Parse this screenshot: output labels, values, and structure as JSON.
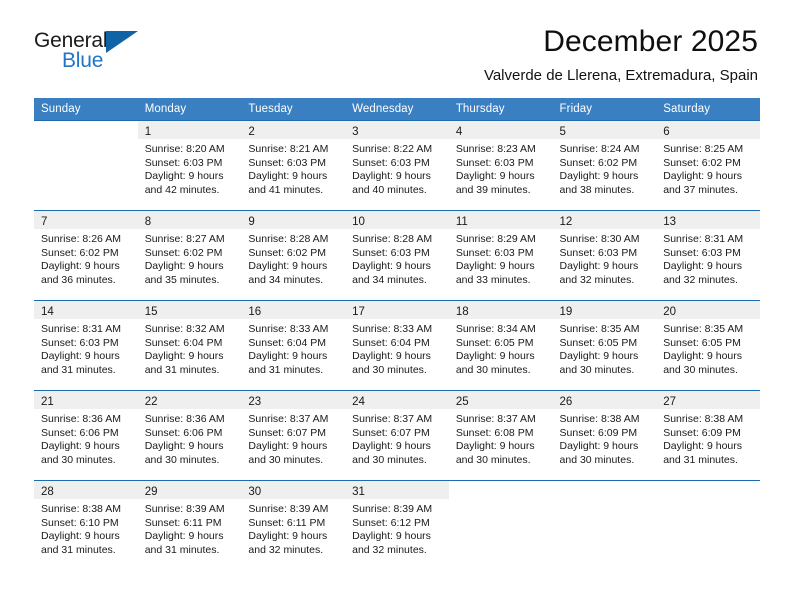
{
  "brand": {
    "word_one": "General",
    "word_two": "Blue",
    "triangle_icon": "triangle-logo-icon",
    "accent_color": "#1163a8",
    "blue_text_color": "#2176c7"
  },
  "header": {
    "title": "December 2025",
    "subtitle": "Valverde de Llerena, Extremadura, Spain"
  },
  "calendar": {
    "header_bg": "#3a7fc1",
    "row_divider_color": "#1e6cb0",
    "daynum_band_color": "#efefef",
    "weekdays": [
      "Sunday",
      "Monday",
      "Tuesday",
      "Wednesday",
      "Thursday",
      "Friday",
      "Saturday"
    ],
    "weeks": [
      [
        {
          "day": "",
          "sunrise": "",
          "sunset": "",
          "daylight_a": "",
          "daylight_b": ""
        },
        {
          "day": "1",
          "sunrise": "Sunrise: 8:20 AM",
          "sunset": "Sunset: 6:03 PM",
          "daylight_a": "Daylight: 9 hours",
          "daylight_b": "and 42 minutes."
        },
        {
          "day": "2",
          "sunrise": "Sunrise: 8:21 AM",
          "sunset": "Sunset: 6:03 PM",
          "daylight_a": "Daylight: 9 hours",
          "daylight_b": "and 41 minutes."
        },
        {
          "day": "3",
          "sunrise": "Sunrise: 8:22 AM",
          "sunset": "Sunset: 6:03 PM",
          "daylight_a": "Daylight: 9 hours",
          "daylight_b": "and 40 minutes."
        },
        {
          "day": "4",
          "sunrise": "Sunrise: 8:23 AM",
          "sunset": "Sunset: 6:03 PM",
          "daylight_a": "Daylight: 9 hours",
          "daylight_b": "and 39 minutes."
        },
        {
          "day": "5",
          "sunrise": "Sunrise: 8:24 AM",
          "sunset": "Sunset: 6:02 PM",
          "daylight_a": "Daylight: 9 hours",
          "daylight_b": "and 38 minutes."
        },
        {
          "day": "6",
          "sunrise": "Sunrise: 8:25 AM",
          "sunset": "Sunset: 6:02 PM",
          "daylight_a": "Daylight: 9 hours",
          "daylight_b": "and 37 minutes."
        }
      ],
      [
        {
          "day": "7",
          "sunrise": "Sunrise: 8:26 AM",
          "sunset": "Sunset: 6:02 PM",
          "daylight_a": "Daylight: 9 hours",
          "daylight_b": "and 36 minutes."
        },
        {
          "day": "8",
          "sunrise": "Sunrise: 8:27 AM",
          "sunset": "Sunset: 6:02 PM",
          "daylight_a": "Daylight: 9 hours",
          "daylight_b": "and 35 minutes."
        },
        {
          "day": "9",
          "sunrise": "Sunrise: 8:28 AM",
          "sunset": "Sunset: 6:02 PM",
          "daylight_a": "Daylight: 9 hours",
          "daylight_b": "and 34 minutes."
        },
        {
          "day": "10",
          "sunrise": "Sunrise: 8:28 AM",
          "sunset": "Sunset: 6:03 PM",
          "daylight_a": "Daylight: 9 hours",
          "daylight_b": "and 34 minutes."
        },
        {
          "day": "11",
          "sunrise": "Sunrise: 8:29 AM",
          "sunset": "Sunset: 6:03 PM",
          "daylight_a": "Daylight: 9 hours",
          "daylight_b": "and 33 minutes."
        },
        {
          "day": "12",
          "sunrise": "Sunrise: 8:30 AM",
          "sunset": "Sunset: 6:03 PM",
          "daylight_a": "Daylight: 9 hours",
          "daylight_b": "and 32 minutes."
        },
        {
          "day": "13",
          "sunrise": "Sunrise: 8:31 AM",
          "sunset": "Sunset: 6:03 PM",
          "daylight_a": "Daylight: 9 hours",
          "daylight_b": "and 32 minutes."
        }
      ],
      [
        {
          "day": "14",
          "sunrise": "Sunrise: 8:31 AM",
          "sunset": "Sunset: 6:03 PM",
          "daylight_a": "Daylight: 9 hours",
          "daylight_b": "and 31 minutes."
        },
        {
          "day": "15",
          "sunrise": "Sunrise: 8:32 AM",
          "sunset": "Sunset: 6:04 PM",
          "daylight_a": "Daylight: 9 hours",
          "daylight_b": "and 31 minutes."
        },
        {
          "day": "16",
          "sunrise": "Sunrise: 8:33 AM",
          "sunset": "Sunset: 6:04 PM",
          "daylight_a": "Daylight: 9 hours",
          "daylight_b": "and 31 minutes."
        },
        {
          "day": "17",
          "sunrise": "Sunrise: 8:33 AM",
          "sunset": "Sunset: 6:04 PM",
          "daylight_a": "Daylight: 9 hours",
          "daylight_b": "and 30 minutes."
        },
        {
          "day": "18",
          "sunrise": "Sunrise: 8:34 AM",
          "sunset": "Sunset: 6:05 PM",
          "daylight_a": "Daylight: 9 hours",
          "daylight_b": "and 30 minutes."
        },
        {
          "day": "19",
          "sunrise": "Sunrise: 8:35 AM",
          "sunset": "Sunset: 6:05 PM",
          "daylight_a": "Daylight: 9 hours",
          "daylight_b": "and 30 minutes."
        },
        {
          "day": "20",
          "sunrise": "Sunrise: 8:35 AM",
          "sunset": "Sunset: 6:05 PM",
          "daylight_a": "Daylight: 9 hours",
          "daylight_b": "and 30 minutes."
        }
      ],
      [
        {
          "day": "21",
          "sunrise": "Sunrise: 8:36 AM",
          "sunset": "Sunset: 6:06 PM",
          "daylight_a": "Daylight: 9 hours",
          "daylight_b": "and 30 minutes."
        },
        {
          "day": "22",
          "sunrise": "Sunrise: 8:36 AM",
          "sunset": "Sunset: 6:06 PM",
          "daylight_a": "Daylight: 9 hours",
          "daylight_b": "and 30 minutes."
        },
        {
          "day": "23",
          "sunrise": "Sunrise: 8:37 AM",
          "sunset": "Sunset: 6:07 PM",
          "daylight_a": "Daylight: 9 hours",
          "daylight_b": "and 30 minutes."
        },
        {
          "day": "24",
          "sunrise": "Sunrise: 8:37 AM",
          "sunset": "Sunset: 6:07 PM",
          "daylight_a": "Daylight: 9 hours",
          "daylight_b": "and 30 minutes."
        },
        {
          "day": "25",
          "sunrise": "Sunrise: 8:37 AM",
          "sunset": "Sunset: 6:08 PM",
          "daylight_a": "Daylight: 9 hours",
          "daylight_b": "and 30 minutes."
        },
        {
          "day": "26",
          "sunrise": "Sunrise: 8:38 AM",
          "sunset": "Sunset: 6:09 PM",
          "daylight_a": "Daylight: 9 hours",
          "daylight_b": "and 30 minutes."
        },
        {
          "day": "27",
          "sunrise": "Sunrise: 8:38 AM",
          "sunset": "Sunset: 6:09 PM",
          "daylight_a": "Daylight: 9 hours",
          "daylight_b": "and 31 minutes."
        }
      ],
      [
        {
          "day": "28",
          "sunrise": "Sunrise: 8:38 AM",
          "sunset": "Sunset: 6:10 PM",
          "daylight_a": "Daylight: 9 hours",
          "daylight_b": "and 31 minutes."
        },
        {
          "day": "29",
          "sunrise": "Sunrise: 8:39 AM",
          "sunset": "Sunset: 6:11 PM",
          "daylight_a": "Daylight: 9 hours",
          "daylight_b": "and 31 minutes."
        },
        {
          "day": "30",
          "sunrise": "Sunrise: 8:39 AM",
          "sunset": "Sunset: 6:11 PM",
          "daylight_a": "Daylight: 9 hours",
          "daylight_b": "and 32 minutes."
        },
        {
          "day": "31",
          "sunrise": "Sunrise: 8:39 AM",
          "sunset": "Sunset: 6:12 PM",
          "daylight_a": "Daylight: 9 hours",
          "daylight_b": "and 32 minutes."
        },
        {
          "day": "",
          "sunrise": "",
          "sunset": "",
          "daylight_a": "",
          "daylight_b": ""
        },
        {
          "day": "",
          "sunrise": "",
          "sunset": "",
          "daylight_a": "",
          "daylight_b": ""
        },
        {
          "day": "",
          "sunrise": "",
          "sunset": "",
          "daylight_a": "",
          "daylight_b": ""
        }
      ]
    ]
  }
}
